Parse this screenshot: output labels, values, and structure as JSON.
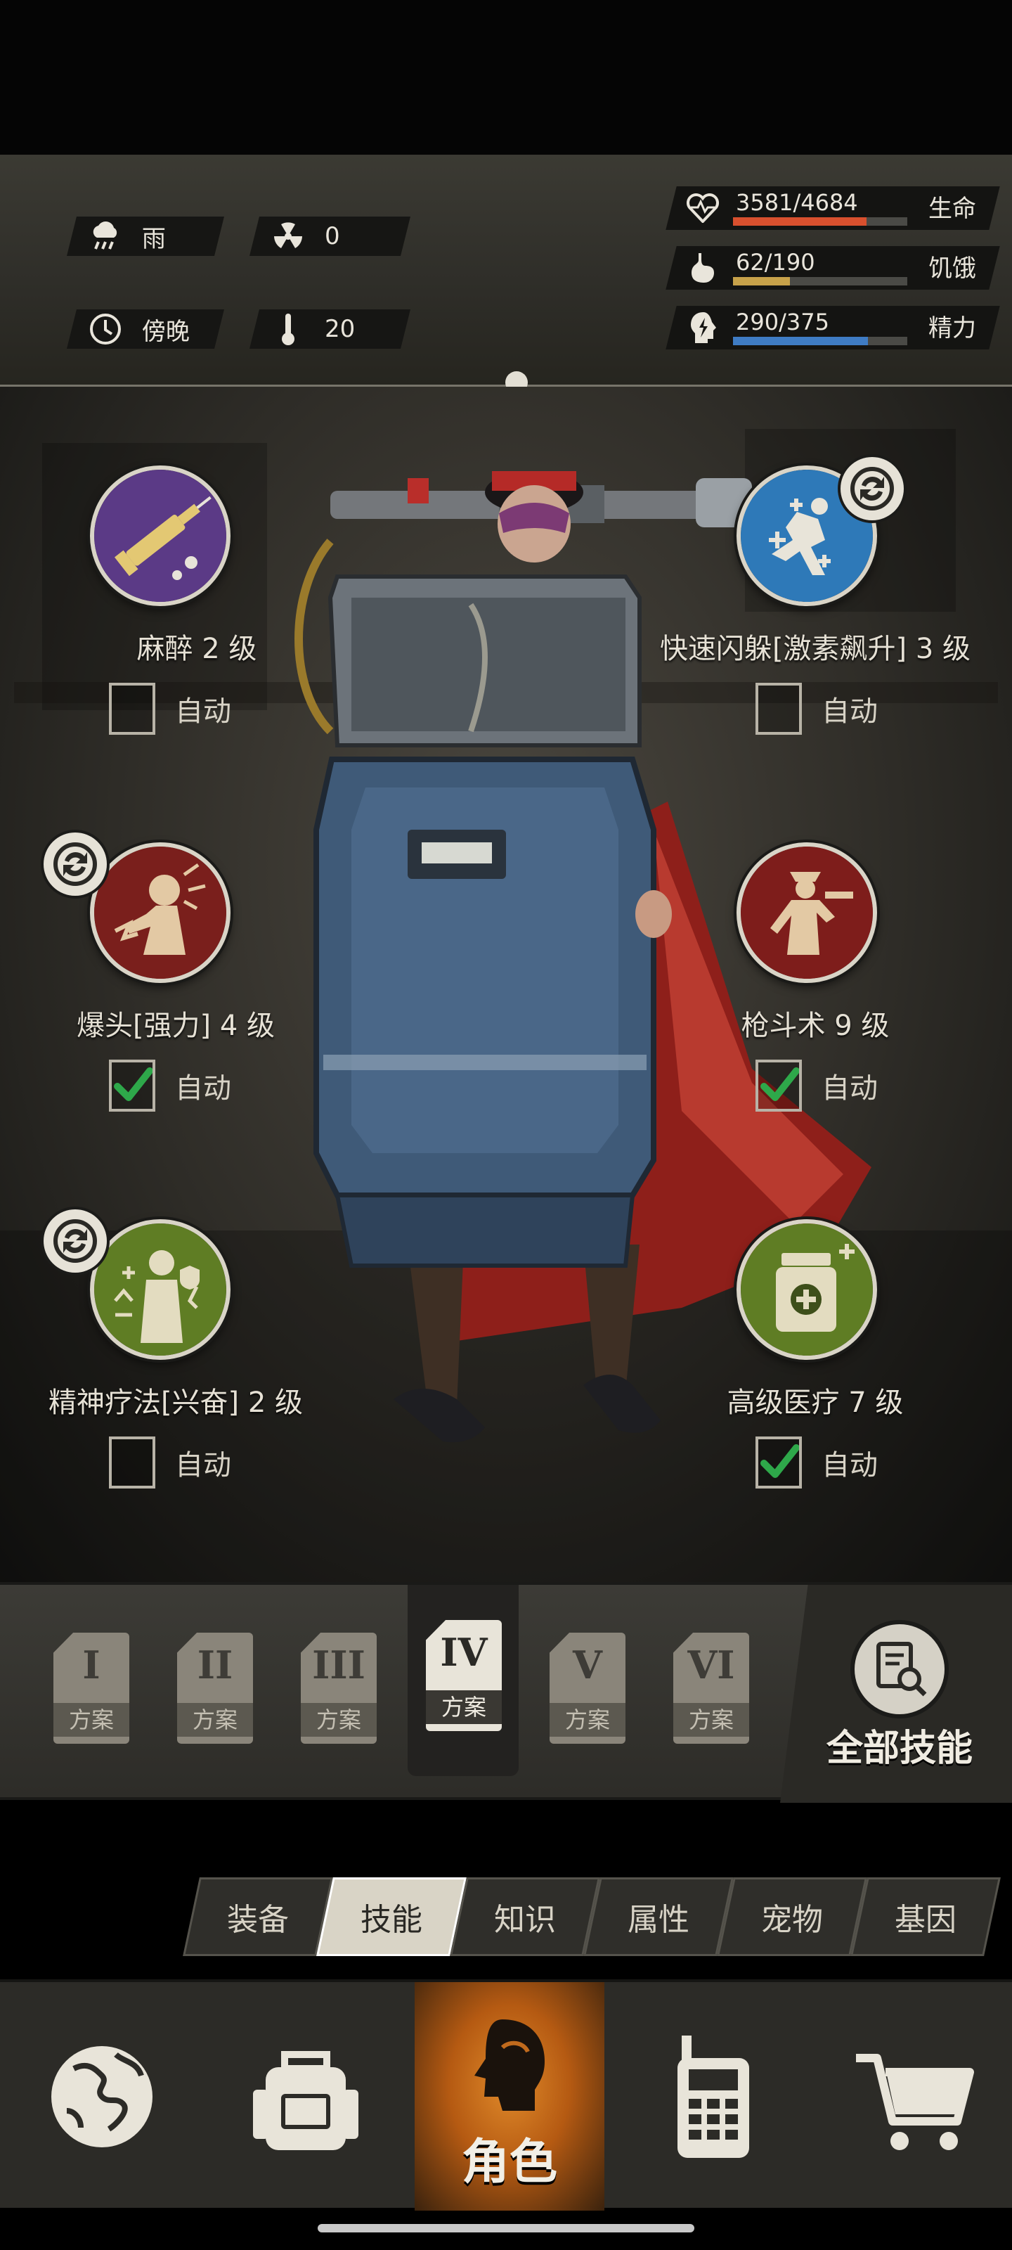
{
  "status": {
    "weather": {
      "icon": "rain-cloud-icon",
      "value": "雨"
    },
    "radiation": {
      "icon": "radiation-icon",
      "value": "0"
    },
    "time": {
      "icon": "clock-icon",
      "value": "傍晚"
    },
    "temperature": {
      "icon": "thermometer-icon",
      "value": "20"
    },
    "life": {
      "icon": "heart-pulse-icon",
      "text": "3581/4684",
      "label": "生命",
      "current": 3581,
      "max": 4684,
      "color": "#d8502e"
    },
    "hunger": {
      "icon": "stomach-icon",
      "text": "62/190",
      "label": "饥饿",
      "current": 62,
      "max": 190,
      "color": "#c7a24a"
    },
    "energy": {
      "icon": "lightning-head-icon",
      "text": "290/375",
      "label": "精力",
      "current": 290,
      "max": 375,
      "color": "#3f7cc4"
    }
  },
  "skills": [
    {
      "name": "麻醉 2 级",
      "auto_label": "自动",
      "auto": false,
      "icon": "syringe-icon",
      "color": "#5b3a86",
      "badge": false
    },
    {
      "name": "快速闪躲[激素飙升] 3 级",
      "auto_label": "自动",
      "auto": false,
      "icon": "dodge-icon",
      "color": "#2e79b8",
      "badge": true
    },
    {
      "name": "爆头[强力] 4 级",
      "auto_label": "自动",
      "auto": true,
      "icon": "headshot-icon",
      "color": "#7a1f1c",
      "badge": true
    },
    {
      "name": "枪斗术 9 级",
      "auto_label": "自动",
      "auto": true,
      "icon": "gunfighter-icon",
      "color": "#7e1d1b",
      "badge": false
    },
    {
      "name": "精神疗法[兴奋] 2 级",
      "auto_label": "自动",
      "auto": false,
      "icon": "psychotherapy-icon",
      "color": "#5f7d24",
      "badge": true
    },
    {
      "name": "高级医疗 7 级",
      "auto_label": "自动",
      "auto": true,
      "icon": "medkit-icon",
      "color": "#5f7d24",
      "badge": false
    }
  ],
  "plans": [
    {
      "roman": "I",
      "label": "方案",
      "active": false
    },
    {
      "roman": "II",
      "label": "方案",
      "active": false
    },
    {
      "roman": "III",
      "label": "方案",
      "active": false
    },
    {
      "roman": "IV",
      "label": "方案",
      "active": true
    },
    {
      "roman": "V",
      "label": "方案",
      "active": false
    },
    {
      "roman": "VI",
      "label": "方案",
      "active": false
    }
  ],
  "all_skills_label": "全部技能",
  "sub_tabs": [
    {
      "label": "装备",
      "active": false
    },
    {
      "label": "技能",
      "active": true
    },
    {
      "label": "知识",
      "active": false
    },
    {
      "label": "属性",
      "active": false
    },
    {
      "label": "宠物",
      "active": false
    },
    {
      "label": "基因",
      "active": false
    }
  ],
  "nav": [
    {
      "icon": "globe-icon",
      "label": ""
    },
    {
      "icon": "backpack-icon",
      "label": ""
    },
    {
      "icon": "character-head-icon",
      "label": "角色",
      "active": true
    },
    {
      "icon": "walkie-talkie-icon",
      "label": ""
    },
    {
      "icon": "shopping-cart-icon",
      "label": ""
    }
  ]
}
